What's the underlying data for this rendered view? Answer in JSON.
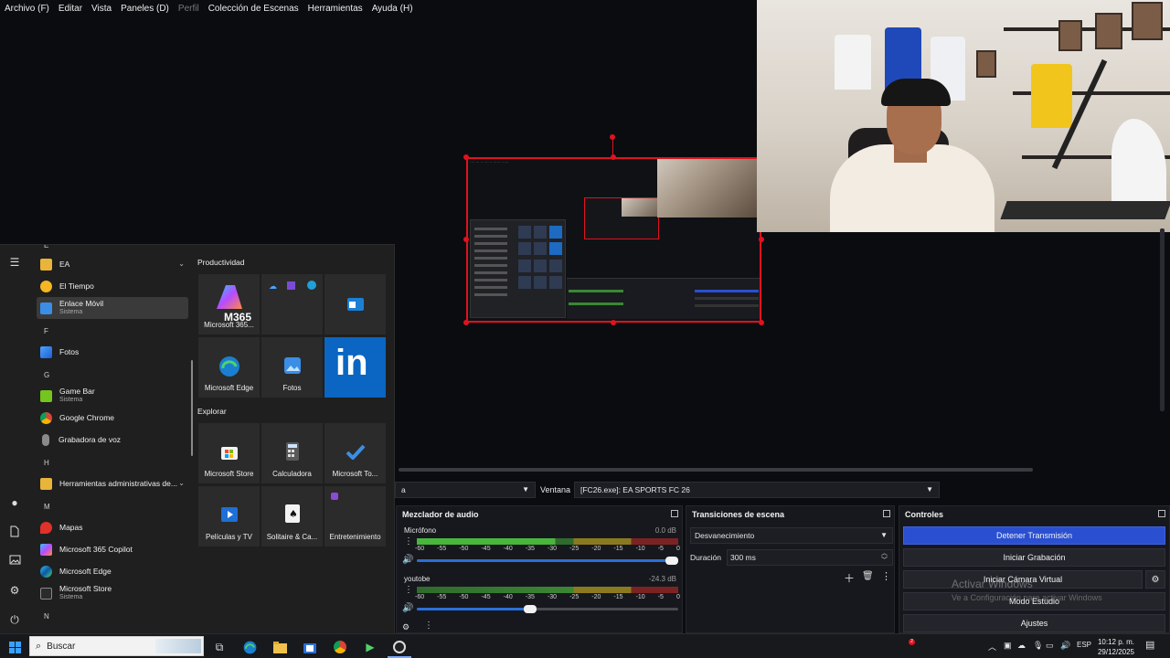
{
  "menubar": {
    "items": [
      "Archivo (F)",
      "Editar",
      "Vista",
      "Paneles (D)",
      "Perfil",
      "Colección de Escenas",
      "Herramientas",
      "Ayuda (H)"
    ]
  },
  "start_menu": {
    "list": {
      "letter_e_group": "EA",
      "el_tiempo": "El Tiempo",
      "enlace_movil": "Enlace Móvil",
      "enlace_movil_sub": "Sistema",
      "letter_f": "F",
      "fotos": "Fotos",
      "letter_g": "G",
      "game_bar": "Game Bar",
      "game_bar_sub": "Sistema",
      "google_chrome": "Google Chrome",
      "grabadora": "Grabadora de voz",
      "letter_h": "H",
      "herramientas": "Herramientas administrativas de...",
      "letter_m": "M",
      "mapas": "Mapas",
      "m365_copilot": "Microsoft 365 Copilot",
      "ms_edge": "Microsoft Edge",
      "ms_store": "Microsoft Store",
      "ms_store_sub": "Sistema",
      "letter_n": "N"
    },
    "groups": {
      "productividad": "Productividad",
      "explorar": "Explorar"
    },
    "tiles": {
      "m365": "Microsoft 365...",
      "m365_logo": "M365",
      "edge": "Microsoft Edge",
      "fotos": "Fotos",
      "linkedin_logo": "in",
      "store": "Microsoft Store",
      "calculadora": "Calculadora",
      "todo": "Microsoft To...",
      "peliculas": "Películas y TV",
      "solitaire": "Solitaire & Ca...",
      "entretenimiento": "Entretenimiento"
    }
  },
  "obs": {
    "props": {
      "window_label": "Ventana",
      "window_value": "[FC26.exe]: EA SPORTS FC 26",
      "left_combo_value": "a"
    },
    "mixer": {
      "title": "Mezclador de audio",
      "ticks": [
        "-60",
        "-55",
        "-50",
        "-45",
        "-40",
        "-35",
        "-30",
        "-25",
        "-20",
        "-15",
        "-10",
        "-5",
        "0"
      ],
      "channels": [
        {
          "name": "Micrófono",
          "db": "0.0 dB",
          "volume": 1.0
        },
        {
          "name": "youtobe",
          "db": "-24.3 dB",
          "volume": 0.43
        }
      ]
    },
    "transitions": {
      "title": "Transiciones de escena",
      "type": "Desvanecimiento",
      "duration_label": "Duración",
      "duration_value": "300 ms"
    },
    "controls": {
      "title": "Controles",
      "stop_stream": "Detener Transmisión",
      "start_record": "Iniciar Grabación",
      "virtual_cam": "Iniciar Cámara Virtual",
      "studio_mode": "Modo Estudio",
      "settings": "Ajustes"
    },
    "watermark": {
      "title": "Activar Windows",
      "subtitle": "Ve a Configuración para activar Windows"
    }
  },
  "taskbar": {
    "search_placeholder": "Buscar",
    "lang": "ESP",
    "time": "10:12 p. m.",
    "date": "29/12/2025",
    "notification_count": "2"
  },
  "colors": {
    "selection_red": "#e0121f",
    "primary_blue": "#2a4fd0",
    "linkedin_blue": "#0a66c2"
  }
}
